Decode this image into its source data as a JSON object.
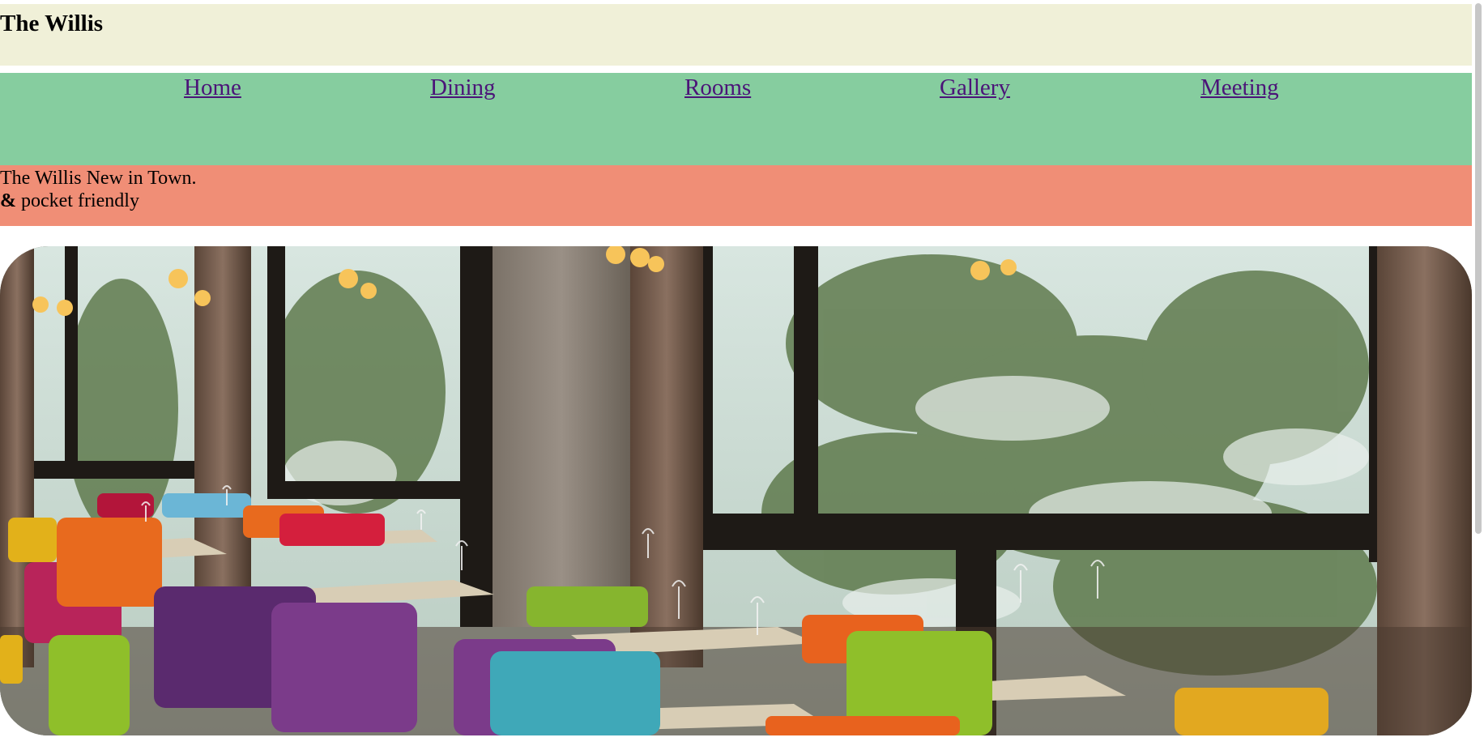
{
  "header": {
    "title": "The Willis"
  },
  "nav": {
    "items": [
      {
        "label": "Home"
      },
      {
        "label": "Dining"
      },
      {
        "label": "Rooms"
      },
      {
        "label": "Gallery"
      },
      {
        "label": "Meeting"
      }
    ]
  },
  "tagline": {
    "line1": "The Willis New in Town.",
    "line2_bold": "&",
    "line2_rest": " pocket friendly"
  },
  "colors": {
    "header_bg": "#f0f0d8",
    "nav_bg": "#86cd9f",
    "tagline_bg": "#f08e76",
    "link": "#4b1478"
  }
}
